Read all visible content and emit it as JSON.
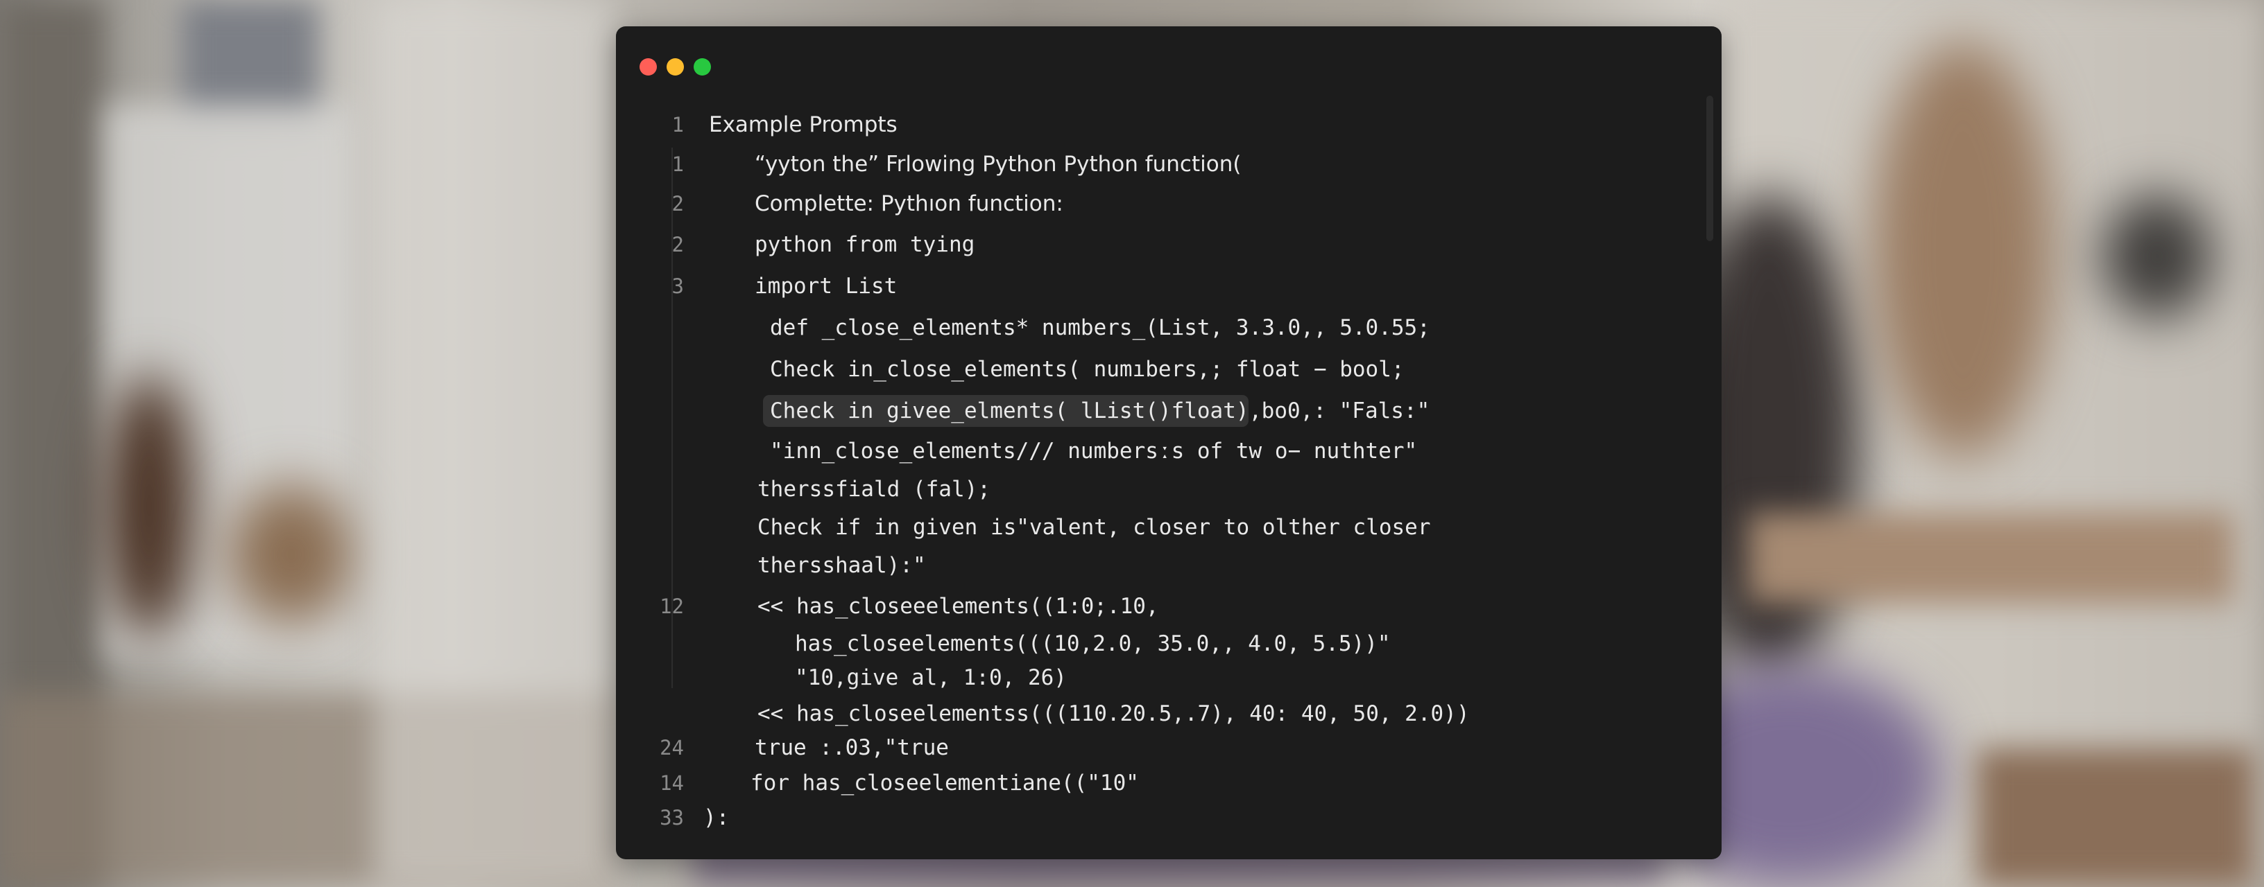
{
  "window": {
    "traffic_lights": [
      {
        "name": "close",
        "color": "#ff5f57"
      },
      {
        "name": "minimize",
        "color": "#febc2e"
      },
      {
        "name": "zoom",
        "color": "#28c840"
      }
    ]
  },
  "editor": {
    "lines": [
      {
        "num": "1",
        "text": "Example Prompts"
      },
      {
        "num": "1",
        "text": "“yyton the” Frlowing Python Python function("
      },
      {
        "num": "2",
        "text": "Complette: Pythıon function:"
      },
      {
        "num": "2",
        "text": "python from tying"
      },
      {
        "num": "3",
        "text": "import List"
      },
      {
        "num": "",
        "text": "def _close_elements* numbers_(List, 3.3.0,, 5.0.55;"
      },
      {
        "num": "",
        "text": "Check in_close_elements( numıbers,; float − bool;"
      },
      {
        "num": "",
        "text": "Check in givee_elments( lList()float),",
        "text_after": " bo0,: \"Fals:\""
      },
      {
        "num": "",
        "text": "\"inn_close_elements/// numbersːs of tw o− nuthter\""
      },
      {
        "num": "",
        "text": "therssfiald (fal);"
      },
      {
        "num": "",
        "text": "Check if in given is\"valent, closer to olther closer"
      },
      {
        "num": "",
        "text": "thersshaal):\""
      },
      {
        "num": "12",
        "text": "<< has_closeeelements((1:0;.10,"
      },
      {
        "num": "",
        "text": "has_closeelements(((10,2.0, 35.0,, 4.0, 5.5))\""
      },
      {
        "num": "",
        "text": "\"10,give al, 1:0, 26)"
      },
      {
        "num": "",
        "text": "<< has_closeelementss(((110.20.5,.7), 40: 40, 50, 2.0))"
      },
      {
        "num": "24",
        "text": "true :.03,\"true"
      },
      {
        "num": "14",
        "text": "for has_closeelementiane((\"10\""
      },
      {
        "num": "33",
        "text": "):"
      }
    ]
  }
}
